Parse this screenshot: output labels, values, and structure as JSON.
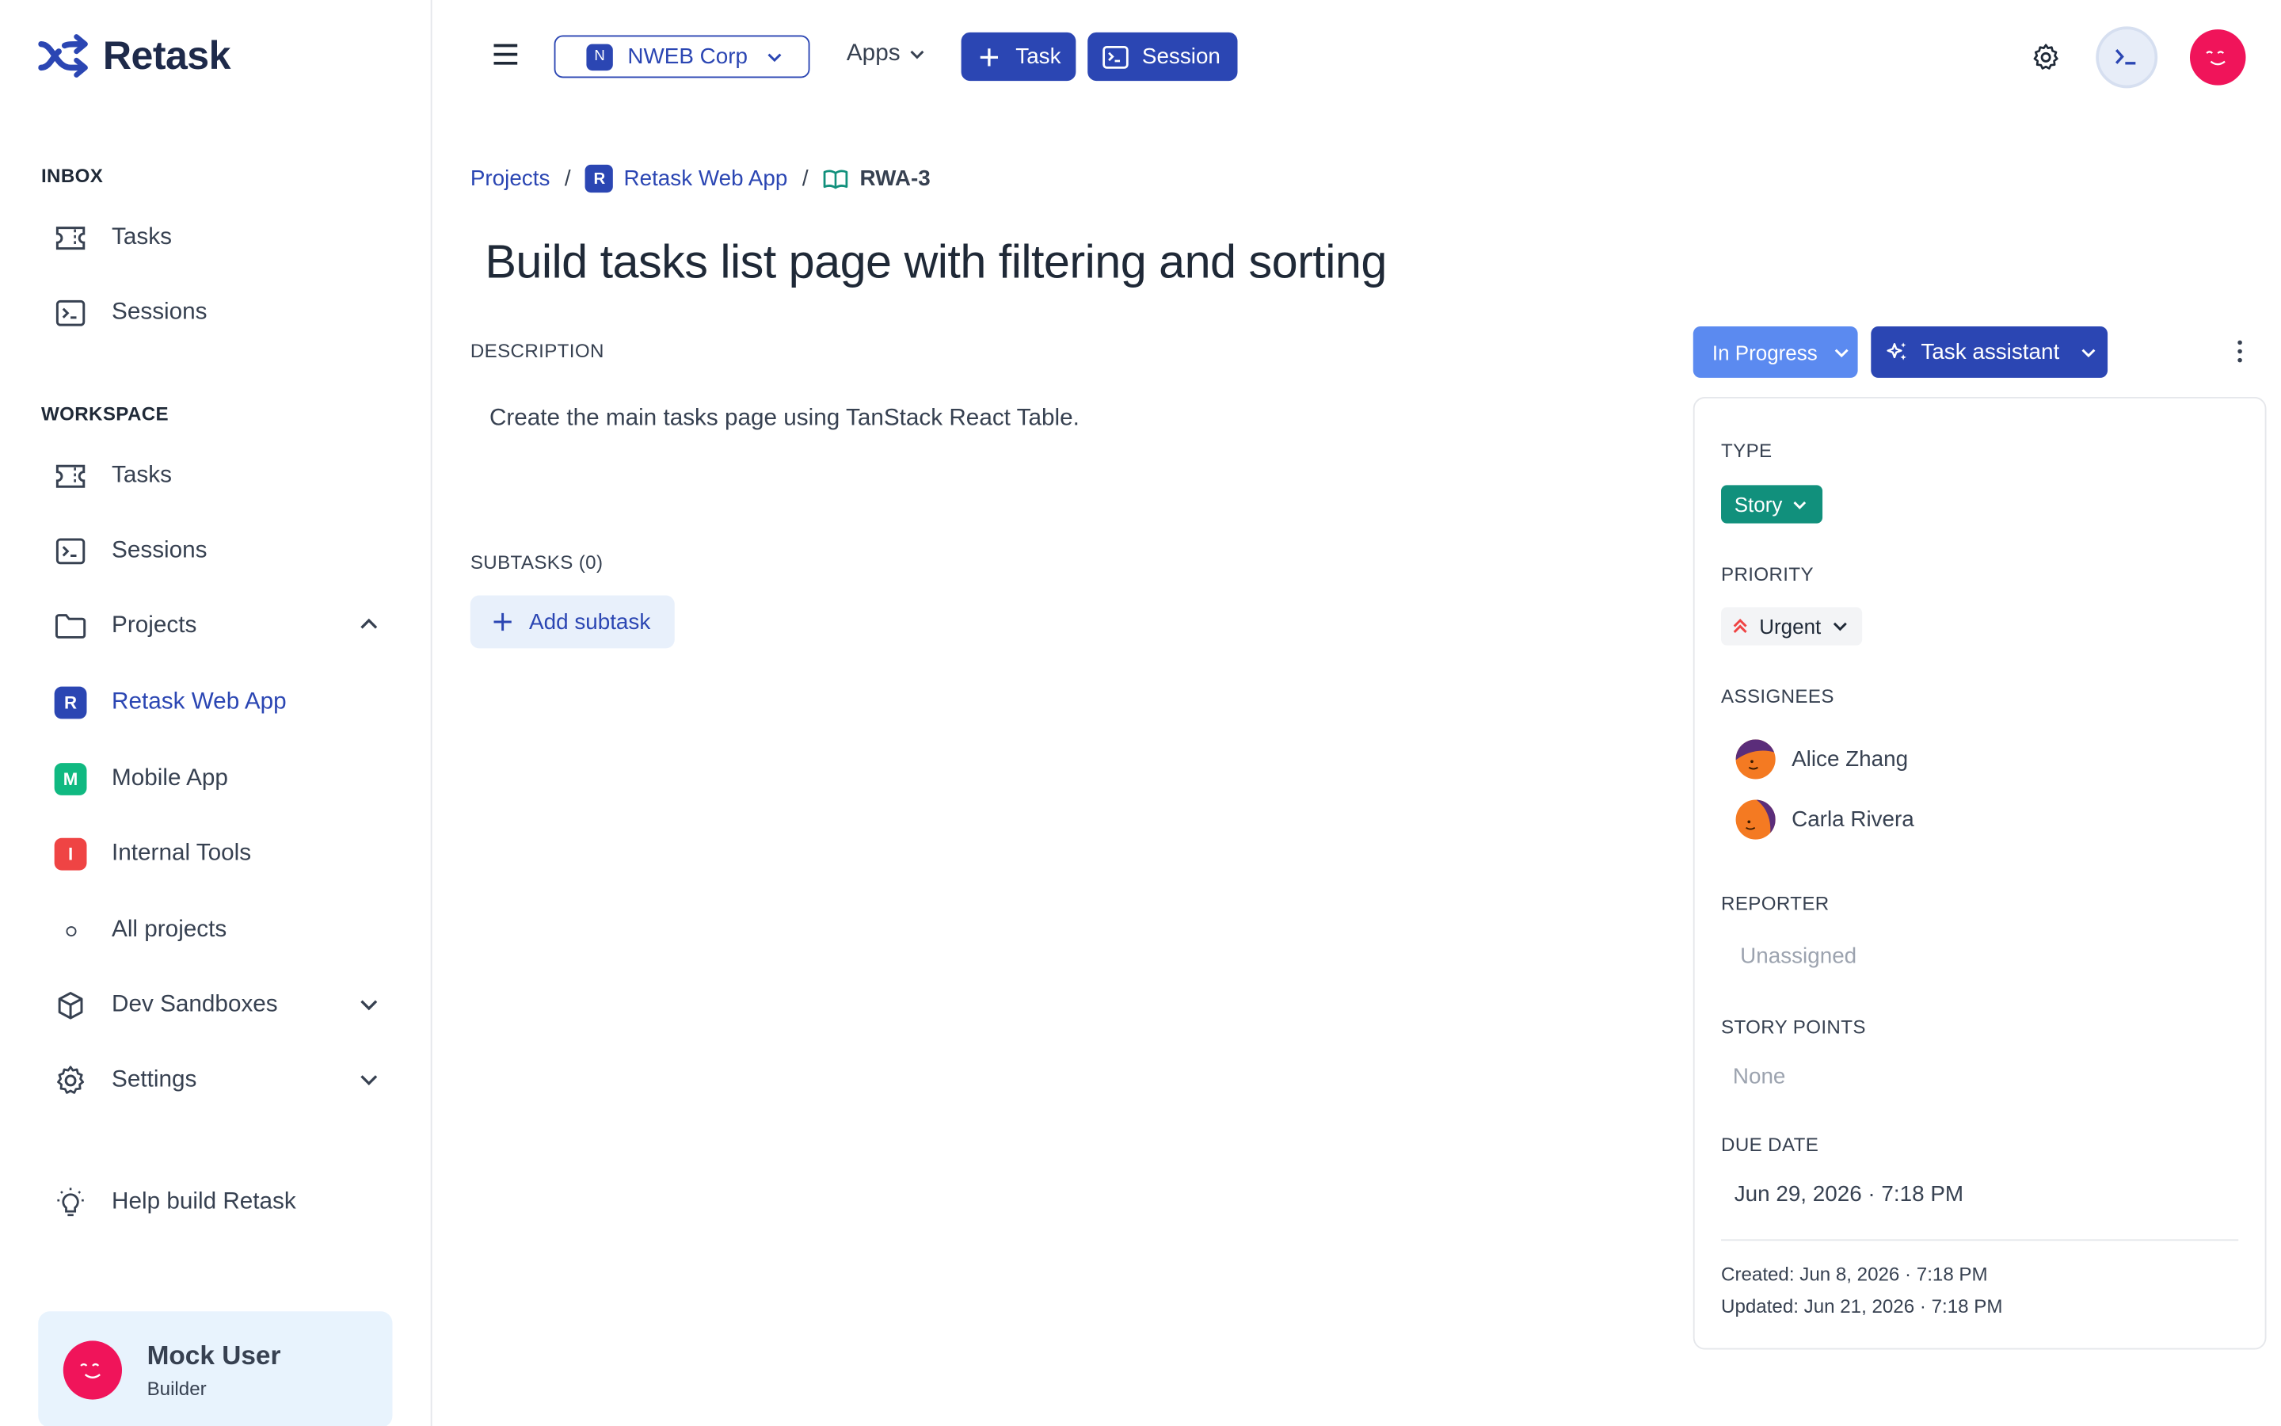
{
  "app": {
    "name": "Retask",
    "brand_color": "#2b46b3"
  },
  "sidebar": {
    "inbox_label": "INBOX",
    "inbox_items": [
      {
        "label": "Tasks",
        "icon": "ticket-icon"
      },
      {
        "label": "Sessions",
        "icon": "terminal-icon"
      }
    ],
    "workspace_label": "WORKSPACE",
    "workspace_items": [
      {
        "label": "Tasks",
        "icon": "ticket-icon"
      },
      {
        "label": "Sessions",
        "icon": "terminal-icon"
      },
      {
        "label": "Projects",
        "icon": "folder-icon"
      }
    ],
    "projects": [
      {
        "label": "Retask Web App",
        "badge": "R",
        "color": "#2b46b3"
      },
      {
        "label": "Mobile App",
        "badge": "M",
        "color": "#10b981"
      },
      {
        "label": "Internal Tools",
        "badge": "I",
        "color": "#ef4444"
      }
    ],
    "all_projects": "All projects",
    "dev_sandboxes": "Dev Sandboxes",
    "settings": "Settings",
    "help": "Help build Retask",
    "user": {
      "name": "Mock User",
      "role": "Builder"
    }
  },
  "topbar": {
    "org_badge": "N",
    "org_name": "NWEB Corp",
    "apps_label": "Apps",
    "task_button": "Task",
    "session_button": "Session"
  },
  "breadcrumb": {
    "projects": "Projects",
    "project_badge": "R",
    "project": "Retask Web App",
    "issue": "RWA-3"
  },
  "task": {
    "title": "Build tasks list page with filtering and sorting",
    "description_label": "DESCRIPTION",
    "description": "Create the main tasks page using TanStack React Table.",
    "subtasks_label": "SUBTASKS (0)",
    "add_subtask": "Add subtask",
    "status": "In Progress",
    "assistant": "Task assistant"
  },
  "details": {
    "type_label": "TYPE",
    "type": "Story",
    "type_color": "#11907c",
    "priority_label": "PRIORITY",
    "priority": "Urgent",
    "assignees_label": "ASSIGNEES",
    "assignees": [
      "Alice Zhang",
      "Carla Rivera"
    ],
    "reporter_label": "REPORTER",
    "reporter": "Unassigned",
    "story_points_label": "STORY POINTS",
    "story_points": "None",
    "due_date_label": "DUE DATE",
    "due_date": "Jun 29, 2026 · 7:18 PM",
    "created": "Created: Jun 8, 2026 · 7:18 PM",
    "updated": "Updated: Jun 21, 2026 · 7:18 PM"
  }
}
